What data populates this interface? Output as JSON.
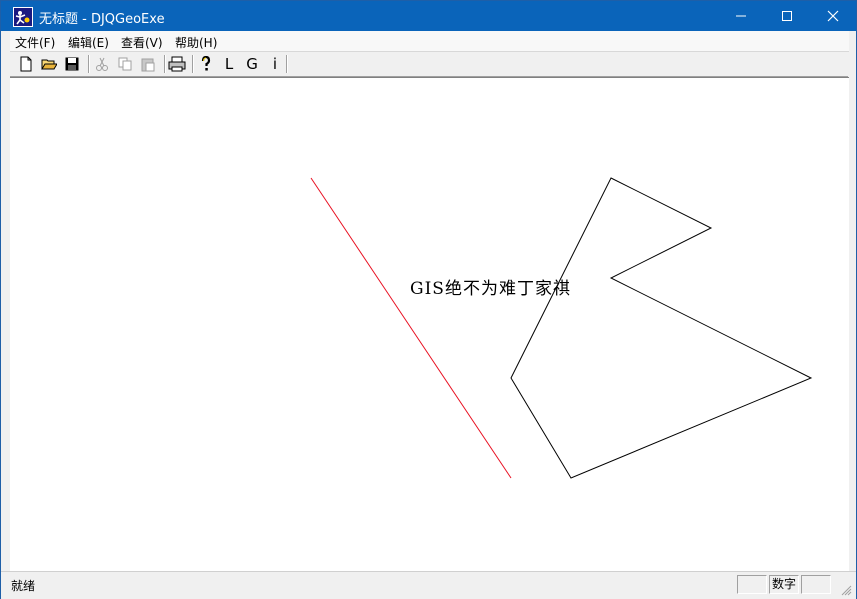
{
  "window": {
    "title": "无标题 - DJQGeoExe"
  },
  "menu": [
    {
      "label": "文件(F)"
    },
    {
      "label": "编辑(E)"
    },
    {
      "label": "查看(V)"
    },
    {
      "label": "帮助(H)"
    }
  ],
  "toolbar": {
    "buttons": [
      {
        "icon": "new-file-icon"
      },
      {
        "icon": "open-folder-icon"
      },
      {
        "icon": "save-icon"
      },
      {
        "icon": "cut-icon",
        "enabled": false
      },
      {
        "icon": "copy-icon",
        "enabled": false
      },
      {
        "icon": "paste-icon",
        "enabled": false
      },
      {
        "icon": "print-icon"
      },
      {
        "icon": "help-icon"
      }
    ],
    "text_buttons": [
      "L",
      "G",
      "i"
    ]
  },
  "canvas": {
    "label_text": "GIS绝不为难丁家祺",
    "line_color": "#e81123",
    "polygon_color": "#000000"
  },
  "status": {
    "text": "就绪",
    "numlock": "数字"
  }
}
